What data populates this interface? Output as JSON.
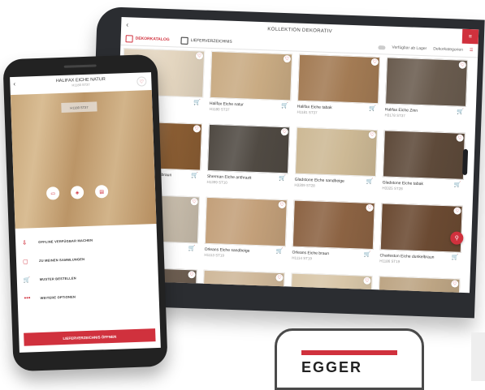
{
  "tablet": {
    "title": "KOLLEKTION DEKORATIV",
    "tabs": [
      {
        "label": "DEKORKATALOG",
        "active": true
      },
      {
        "label": "LIEFERVERZEICHNIS",
        "active": false
      }
    ],
    "toggle_label": "Verfügbar ab Lager",
    "sort_label": "Dekorkategorien",
    "decors": [
      {
        "name": "Halifax Eiche weiss",
        "code": "H1176 ST37",
        "color": "#e3d5bf"
      },
      {
        "name": "Halifax Eiche natur",
        "code": "H1180 ST37",
        "color": "#c9ab83"
      },
      {
        "name": "Halifax Eiche tabak",
        "code": "H1181 ST37",
        "color": "#a37b54"
      },
      {
        "name": "Halifax Eiche Zinn",
        "code": "H3178 ST37",
        "color": "#6a5c4f"
      },
      {
        "name": "Sherman Eiche cognacbraun",
        "code": "H1344 ST32",
        "color": "#8a5d33"
      },
      {
        "name": "Sherman Eiche anthrazit",
        "code": "H1399 ST10",
        "color": "#504a43"
      },
      {
        "name": "Gladstone Eiche sandbeige",
        "code": "H3309 ST28",
        "color": "#cdb995"
      },
      {
        "name": "Gladstone Eiche tabak",
        "code": "H3325 ST28",
        "color": "#5e4a3a"
      },
      {
        "name": "Gladstone Eiche greige",
        "code": "H3335 ST28",
        "color": "#c7bcab"
      },
      {
        "name": "Orleans Eiche sandbeige",
        "code": "H1113 ST19",
        "color": "#c3a07a"
      },
      {
        "name": "Orleans Eiche braun",
        "code": "H1114 ST19",
        "color": "#8c6343"
      },
      {
        "name": "Charleston Eiche dunkelbraun",
        "code": "H1186 ST19",
        "color": "#6b4a32"
      },
      {
        "name": "",
        "code": "",
        "color": "#6e5f52"
      },
      {
        "name": "",
        "code": "",
        "color": "#cfb89a"
      },
      {
        "name": "",
        "code": "",
        "color": "#d8c6a8"
      },
      {
        "name": "",
        "code": "",
        "color": "#bda584"
      }
    ]
  },
  "phone": {
    "title": "HALIFAX EICHE NATUR",
    "code": "H1180 ST37",
    "wood_tag": "H1180 ST37",
    "menu": [
      {
        "icon": "⇩",
        "label": "OFFLINE VERFÜGBAR MACHEN"
      },
      {
        "icon": "▢",
        "label": "ZU MEINEN SAMMLUNGEN"
      },
      {
        "icon": "🛒",
        "label": "MUSTER BESTELLEN"
      },
      {
        "icon": "•••",
        "label": "WEITERE OPTIONEN"
      }
    ],
    "cta_label": "LIEFERVERZEICHNIS ÖFFNEN"
  },
  "logo": {
    "text": "EGGER",
    "brand_color": "#d0313d"
  }
}
